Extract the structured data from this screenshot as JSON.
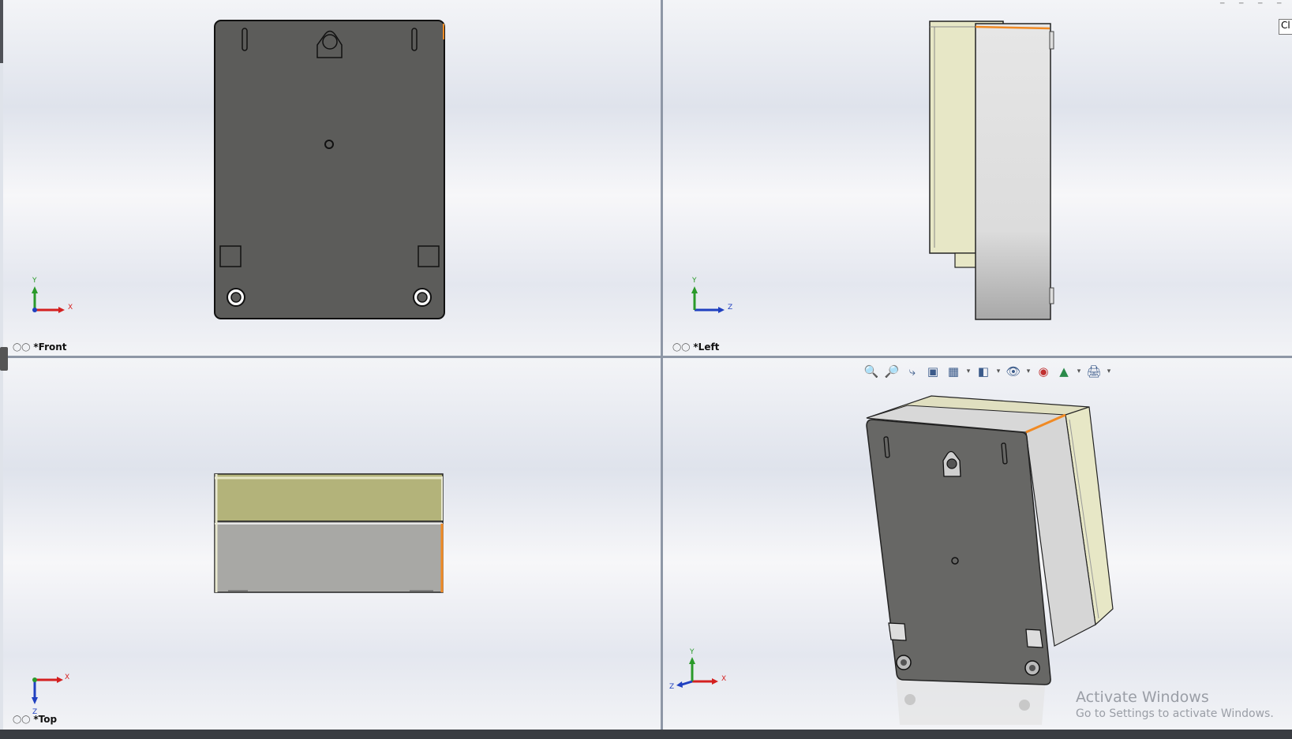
{
  "viewports": {
    "front": {
      "label": "*Front",
      "axes": {
        "x": "X",
        "y": "Y"
      }
    },
    "left": {
      "label": "*Left",
      "axes": {
        "x": "Z",
        "y": "Y"
      }
    },
    "top": {
      "label": "*Top",
      "axes": {
        "x": "X",
        "y": "Z"
      }
    },
    "iso": {
      "label": "",
      "axes": {
        "x": "X",
        "y": "Y",
        "z": "Z"
      }
    }
  },
  "toolbar": {
    "items": [
      "zoom-to-fit-icon",
      "zoom-to-area-icon",
      "previous-view-icon",
      "section-view-icon",
      "view-orientation-icon",
      "display-style-icon",
      "hide-show-items-icon",
      "edit-appearance-icon",
      "apply-scene-icon",
      "view-settings-icon"
    ]
  },
  "corner_tab": "Cl",
  "watermark": {
    "line1": "Activate Windows",
    "line2": "Go to Settings to activate Windows."
  },
  "colors": {
    "body_dark": "#5c5c5a",
    "cover_yellow": "#e7e7c6",
    "body_grey": "#d2d2d2",
    "edge_highlight": "#f08a24",
    "axis_x": "#d42020",
    "axis_y": "#2a9a2a",
    "axis_z": "#2040c0"
  }
}
